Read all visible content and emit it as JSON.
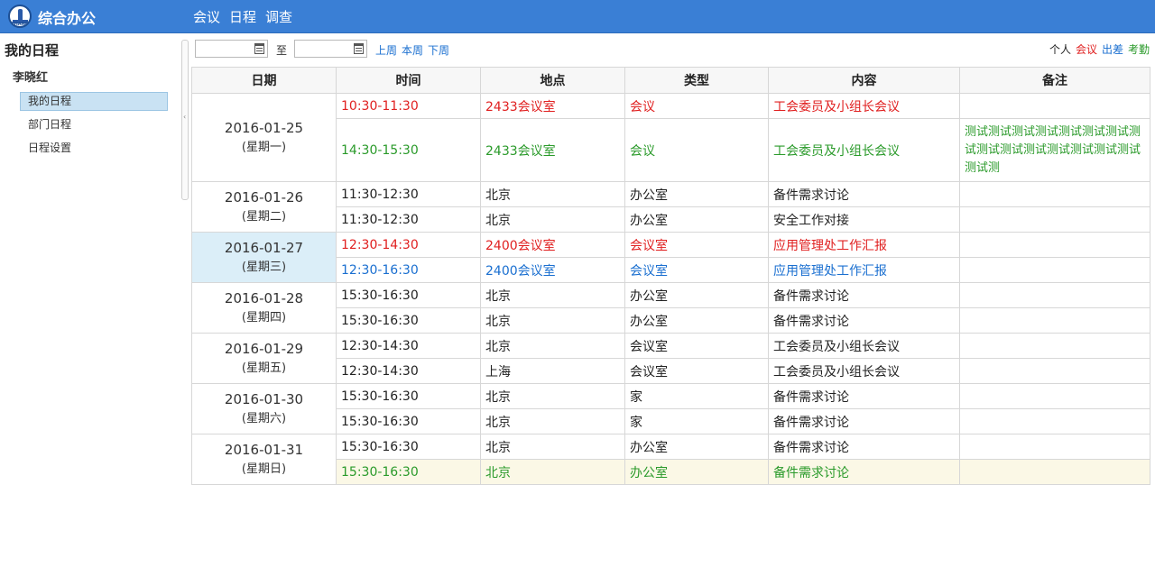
{
  "header": {
    "logo_text": "SHANGHAI",
    "title": "综合办公",
    "nav": [
      "会议",
      "日程",
      "调查"
    ]
  },
  "sidebar": {
    "title": "我的日程",
    "user": "李晓红",
    "items": [
      {
        "label": "我的日程",
        "active": true
      },
      {
        "label": "部门日程",
        "active": false
      },
      {
        "label": "日程设置",
        "active": false
      }
    ]
  },
  "toolbar": {
    "start_date": "",
    "end_date": "",
    "to_label": "至",
    "prev_week": "上周",
    "this_week": "本周",
    "next_week": "下周",
    "legend": [
      {
        "label": "个人",
        "color": "#222222"
      },
      {
        "label": "会议",
        "color": "#e02020"
      },
      {
        "label": "出差",
        "color": "#1a6fd0"
      },
      {
        "label": "考勤",
        "color": "#2a9a2a"
      }
    ]
  },
  "table": {
    "headers": [
      "日期",
      "时间",
      "地点",
      "类型",
      "内容",
      "备注"
    ],
    "days": [
      {
        "date": "2016-01-25",
        "weekday": "(星期一)",
        "entries": [
          {
            "time": "10:30-11:30",
            "place": "2433会议室",
            "type": "会议",
            "content": "工会委员及小组长会议",
            "note": "",
            "color": "red"
          },
          {
            "time": "14:30-15:30",
            "place": "2433会议室",
            "type": "会议",
            "content": "工会委员及小组长会议",
            "note": "测试测试测试测试测试测试测试测试测试测试测试测试测试测试测试测试测",
            "color": "green"
          }
        ]
      },
      {
        "date": "2016-01-26",
        "weekday": "(星期二)",
        "entries": [
          {
            "time": "11:30-12:30",
            "place": "北京",
            "type": "办公室",
            "content": "备件需求讨论",
            "note": "",
            "color": "black"
          },
          {
            "time": "11:30-12:30",
            "place": "北京",
            "type": "办公室",
            "content": "安全工作对接",
            "note": "",
            "color": "black"
          }
        ]
      },
      {
        "date": "2016-01-27",
        "weekday": "(星期三)",
        "highlight": true,
        "entries": [
          {
            "time": "12:30-14:30",
            "place": "2400会议室",
            "type": "会议室",
            "content": "应用管理处工作汇报",
            "note": "",
            "color": "red"
          },
          {
            "time": "12:30-16:30",
            "place": "2400会议室",
            "type": "会议室",
            "content": "应用管理处工作汇报",
            "note": "",
            "color": "blue"
          }
        ]
      },
      {
        "date": "2016-01-28",
        "weekday": "(星期四)",
        "entries": [
          {
            "time": "15:30-16:30",
            "place": "北京",
            "type": "办公室",
            "content": "备件需求讨论",
            "note": "",
            "color": "black"
          },
          {
            "time": "15:30-16:30",
            "place": "北京",
            "type": "办公室",
            "content": "备件需求讨论",
            "note": "",
            "color": "black"
          }
        ]
      },
      {
        "date": "2016-01-29",
        "weekday": "(星期五)",
        "entries": [
          {
            "time": "12:30-14:30",
            "place": "北京",
            "type": "会议室",
            "content": "工会委员及小组长会议",
            "note": "",
            "color": "black"
          },
          {
            "time": "12:30-14:30",
            "place": "上海",
            "type": "会议室",
            "content": "工会委员及小组长会议",
            "note": "",
            "color": "black"
          }
        ]
      },
      {
        "date": "2016-01-30",
        "weekday": "(星期六)",
        "entries": [
          {
            "time": "15:30-16:30",
            "place": "北京",
            "type": "家",
            "content": "备件需求讨论",
            "note": "",
            "color": "black"
          },
          {
            "time": "15:30-16:30",
            "place": "北京",
            "type": "家",
            "content": "备件需求讨论",
            "note": "",
            "color": "black"
          }
        ]
      },
      {
        "date": "2016-01-31",
        "weekday": "(星期日)",
        "entries": [
          {
            "time": "15:30-16:30",
            "place": "北京",
            "type": "办公室",
            "content": "备件需求讨论",
            "note": "",
            "color": "black"
          },
          {
            "time": "15:30-16:30",
            "place": "北京",
            "type": "办公室",
            "content": "备件需求讨论",
            "note": "",
            "color": "green",
            "selected": true
          }
        ]
      }
    ]
  }
}
